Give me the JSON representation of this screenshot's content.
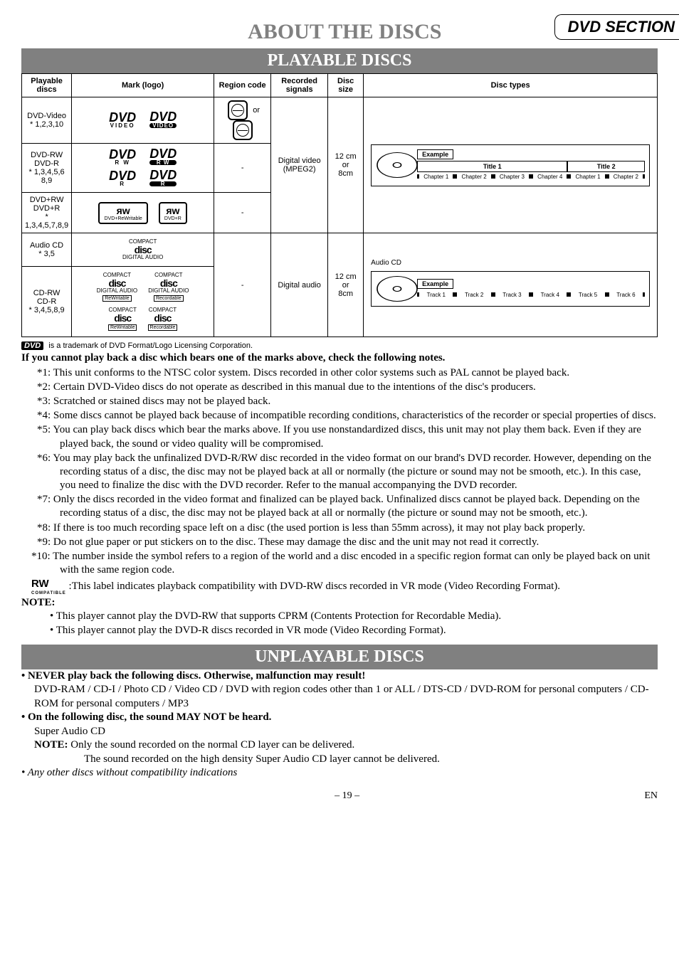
{
  "section_tag": "DVD SECTION",
  "main_title": "ABOUT THE DISCS",
  "playable_band": "PLAYABLE DISCS",
  "unplayable_band": "UNPLAYABLE DISCS",
  "headers": {
    "playable": "Playable discs",
    "mark": "Mark (logo)",
    "region": "Region code",
    "recorded": "Recorded signals",
    "size": "Disc size",
    "types": "Disc types"
  },
  "rows": {
    "dvd_video": {
      "name": "DVD-Video",
      "star": "* 1,2,3,10"
    },
    "dvd_rw": {
      "name": "DVD-RW\nDVD-R",
      "star": "* 1,3,4,5,6\n8,9"
    },
    "dvd_plus": {
      "name": "DVD+RW\nDVD+R",
      "star": "* 1,3,4,5,7,8,9"
    },
    "audio_cd": {
      "name": "Audio CD",
      "star": "* 3,5"
    },
    "cd_rw": {
      "name": "CD-RW\nCD-R",
      "star": "* 3,4,5,8,9"
    }
  },
  "region_or": "or",
  "region_dash1": "-",
  "region_dash2": "-",
  "region_dash3": "-",
  "recorded_signals": {
    "video": "Digital video\n(MPEG2)",
    "audio": "Digital audio"
  },
  "disc_size": "12 cm\nor\n8cm",
  "example_label": "Example",
  "dvd_example": {
    "title1": "Title 1",
    "title2": "Title 2",
    "ch1": "Chapter 1",
    "ch2": "Chapter 2",
    "ch3": "Chapter 3",
    "ch4": "Chapter 4",
    "ch5": "Chapter 1",
    "ch6": "Chapter 2"
  },
  "cd_example": {
    "label": "Audio CD",
    "t1": "Track 1",
    "t2": "Track 2",
    "t3": "Track 3",
    "t4": "Track 4",
    "t5": "Track 5",
    "t6": "Track 6"
  },
  "logos": {
    "dvd": "DVD",
    "video": "VIDEO",
    "rw": "R W",
    "r": "R",
    "rw_box": "ᴙw",
    "rw_sub1": "DVD+ReWritable",
    "rw_sub2": "DVD+R",
    "compact": "COMPACT",
    "disc": "disc",
    "digaudio": "DIGITAL AUDIO",
    "rewritable": "ReWritable",
    "recordable": "Recordable"
  },
  "trademark": "is a trademark of DVD Format/Logo Licensing Corporation.",
  "notes_lead": "If you cannot play back a disc which bears one of the marks above, check the following notes.",
  "notes": {
    "n1": "*1: This unit conforms to the NTSC color system. Discs recorded in other color systems such as PAL cannot be played back.",
    "n2": "*2: Certain DVD-Video discs do not operate as described in this manual due to the intentions of the disc's producers.",
    "n3": "*3: Scratched or stained discs may not be played back.",
    "n4": "*4: Some discs cannot be played back because of incompatible recording conditions, characteristics of the recorder or special properties of discs.",
    "n5": "*5: You can play back discs which bear the marks above. If you use nonstandardized discs, this unit may not play them back. Even if they are played back, the sound or video quality will be compromised.",
    "n6": "*6: You may play back the unfinalized DVD-R/RW disc recorded in the video format on our brand's DVD recorder. However, depending on the recording status of a disc, the disc may not be played back at all or normally (the picture or sound may not be smooth, etc.). In this case, you need to finalize the disc with the DVD recorder. Refer to the manual accompanying the DVD recorder.",
    "n7": "*7: Only the discs recorded in the video format and finalized can be played back. Unfinalized discs cannot be played back. Depending on the recording status of a disc, the disc may not be played back at all or normally (the picture or sound may not be smooth, etc.).",
    "n8": "*8: If there is too much recording space left on a disc (the used portion is less than 55mm across), it may not play back properly.",
    "n9": "*9: Do not glue paper or put stickers on to the disc. These may damage the disc and the unit may not read it correctly.",
    "n10": "*10: The number inside the symbol refers to a region of the world and a disc encoded in a specific region format can only be played back on unit with the same region code.",
    "rw_compat": ":This label indicates playback compatibility with DVD-RW discs recorded in VR mode (Video Recording Format).",
    "rw_logo": "RW",
    "rw_logo_sub": "COMPATIBLE"
  },
  "note_label": "NOTE:",
  "note_b1": "• This player cannot play the DVD-RW that supports CPRM (Contents Protection for Recordable Media).",
  "note_b2": "• This player cannot play the DVD-R discs recorded in VR mode (Video Recording Format).",
  "unplayable": {
    "b1_lead": "• NEVER play back the following discs. Otherwise, malfunction may result!",
    "b1_body": "DVD-RAM / CD-I / Photo CD / Video CD / DVD with region codes other than 1 or ALL / DTS-CD / DVD-ROM for personal computers / CD-ROM for personal computers / MP3",
    "b2_lead": "• On the following disc, the sound MAY NOT be heard.",
    "b2_body": "Super Audio CD",
    "b2_note_label": "NOTE:",
    "b2_note1": "Only the sound recorded on the normal CD layer can be delivered.",
    "b2_note2": "The sound recorded on the high density Super Audio CD layer cannot be delivered.",
    "b3": "• Any other discs without compatibility indications"
  },
  "footer": {
    "page": "– 19 –",
    "lang": "EN"
  }
}
